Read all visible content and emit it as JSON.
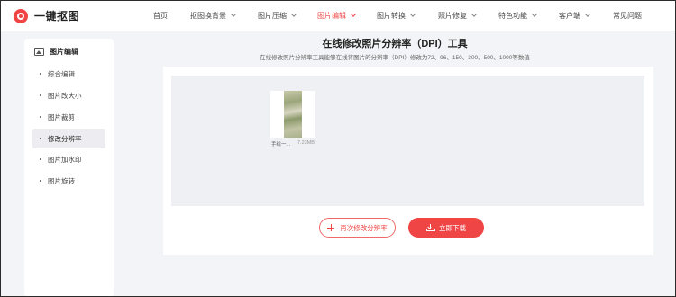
{
  "header": {
    "logo_text": "一键抠图",
    "nav": [
      {
        "label": "首页",
        "has_menu": false,
        "active": false
      },
      {
        "label": "抠图换背景",
        "has_menu": true,
        "active": false
      },
      {
        "label": "图片压缩",
        "has_menu": true,
        "active": false
      },
      {
        "label": "图片编辑",
        "has_menu": true,
        "active": true
      },
      {
        "label": "图片转换",
        "has_menu": true,
        "active": false
      },
      {
        "label": "照片修复",
        "has_menu": true,
        "active": false
      },
      {
        "label": "特色功能",
        "has_menu": true,
        "active": false
      },
      {
        "label": "客户端",
        "has_menu": true,
        "active": false
      },
      {
        "label": "常见问题",
        "has_menu": false,
        "active": false
      }
    ]
  },
  "sidebar": {
    "title": "图片编辑",
    "items": [
      {
        "label": "综合编辑",
        "active": false
      },
      {
        "label": "图片改大小",
        "active": false
      },
      {
        "label": "图片裁剪",
        "active": false
      },
      {
        "label": "修改分辨率",
        "active": true
      },
      {
        "label": "图片加水印",
        "active": false
      },
      {
        "label": "图片旋转",
        "active": false
      }
    ]
  },
  "main": {
    "title": "在线修改照片分辨率（DPI）工具",
    "subtitle": "在线修改照片分辨率工具能够在线将图片的分辨率（DPI）修改为72、96、150、300、500、1000等数值",
    "file": {
      "name": "手绘一...",
      "size": "7.23MB"
    },
    "redo_button": "再次修改分辨率",
    "download_button": "立即下载"
  },
  "colors": {
    "accent": "#f04545",
    "sidebar_active_bg": "#ededf1",
    "drop_bg": "#eef0f4"
  }
}
